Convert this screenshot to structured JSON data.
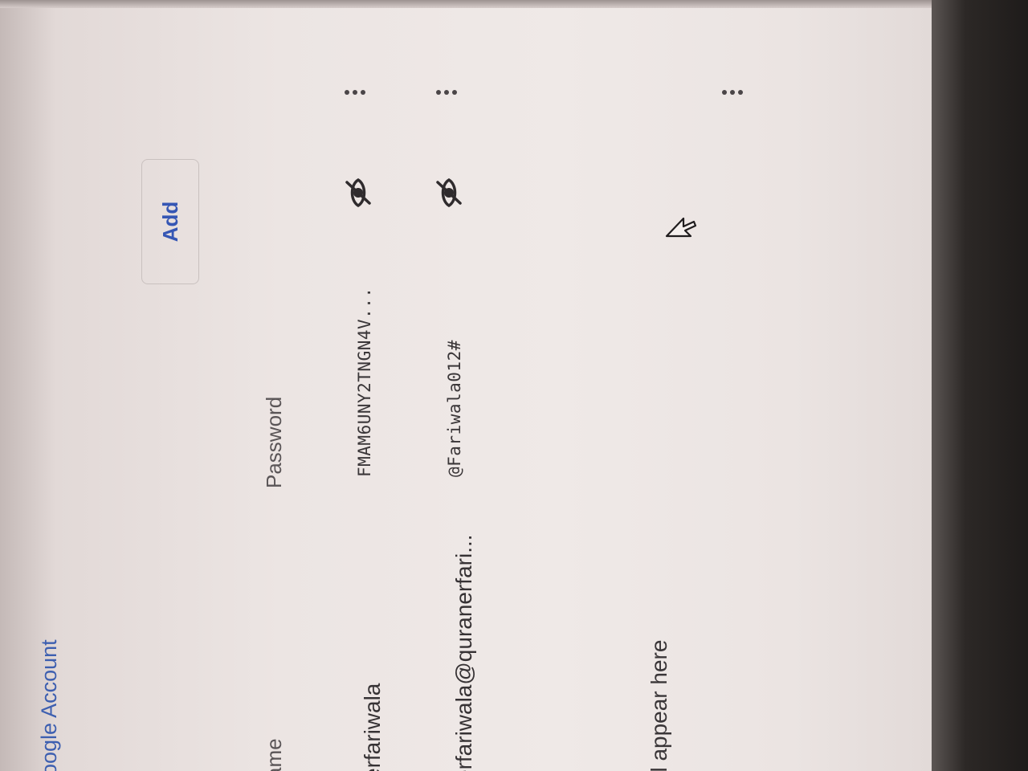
{
  "header": {
    "account_link": "oogle Account",
    "add_button": "Add",
    "more_icon": "more-vert-icon"
  },
  "table": {
    "columns": [
      "ame",
      "Password"
    ],
    "rows": [
      {
        "username": "erfariwala",
        "password": "FMAM6UNY2TNGN4V...",
        "visibility_icon": "eye-off-icon",
        "menu_icon": "more-vert-icon"
      },
      {
        "username": "erfariwala@quranerfari...",
        "password": "@Fariwala012#",
        "visibility_icon": "eye-off-icon",
        "menu_icon": "more-vert-icon"
      }
    ]
  },
  "empty_state": "ill appear here",
  "colors": {
    "link": "#3d5fb0",
    "button_text": "#3556b4",
    "text": "#363234",
    "background": "#ece5e3"
  }
}
